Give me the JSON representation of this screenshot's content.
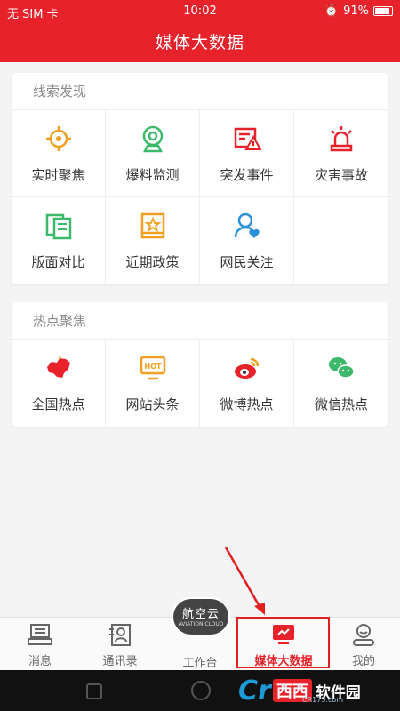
{
  "status_bar": {
    "carrier": "无 SIM 卡",
    "time": "10:02",
    "battery": "91%"
  },
  "header": {
    "title": "媒体大数据"
  },
  "clues": {
    "title": "线索发现",
    "items": [
      {
        "label": "实时聚焦",
        "icon": "target-icon"
      },
      {
        "label": "爆料监测",
        "icon": "camera-icon"
      },
      {
        "label": "突发事件",
        "icon": "alert-icon"
      },
      {
        "label": "灾害事故",
        "icon": "siren-icon"
      },
      {
        "label": "版面对比",
        "icon": "pages-icon"
      },
      {
        "label": "近期政策",
        "icon": "policy-book-icon"
      },
      {
        "label": "网民关注",
        "icon": "user-heart-icon"
      }
    ]
  },
  "hot": {
    "title": "热点聚焦",
    "items": [
      {
        "label": "全国热点",
        "icon": "china-map-icon"
      },
      {
        "label": "网站头条",
        "icon": "hot-screen-icon"
      },
      {
        "label": "微博热点",
        "icon": "weibo-icon"
      },
      {
        "label": "微信热点",
        "icon": "wechat-icon"
      }
    ],
    "hot_badge": "HOT"
  },
  "nav": {
    "items": [
      {
        "label": "消息",
        "icon": "message-icon"
      },
      {
        "label": "通讯录",
        "icon": "contacts-icon"
      },
      {
        "label": "工作台",
        "icon": "workbench-icon"
      },
      {
        "label": "媒体大数据",
        "icon": "bigdata-icon"
      },
      {
        "label": "我的",
        "icon": "profile-icon"
      }
    ],
    "active_index": 3,
    "center_badge": "航空云",
    "center_badge_sub": "AVIATION CLOUD"
  },
  "watermark": {
    "logo": "Cr",
    "red": "西西",
    "text": "软件园",
    "sub": "CR173.com"
  },
  "colors": {
    "accent": "#e8222a",
    "orange": "#f0a020",
    "green": "#3cb96b",
    "blue": "#2a90d8"
  }
}
